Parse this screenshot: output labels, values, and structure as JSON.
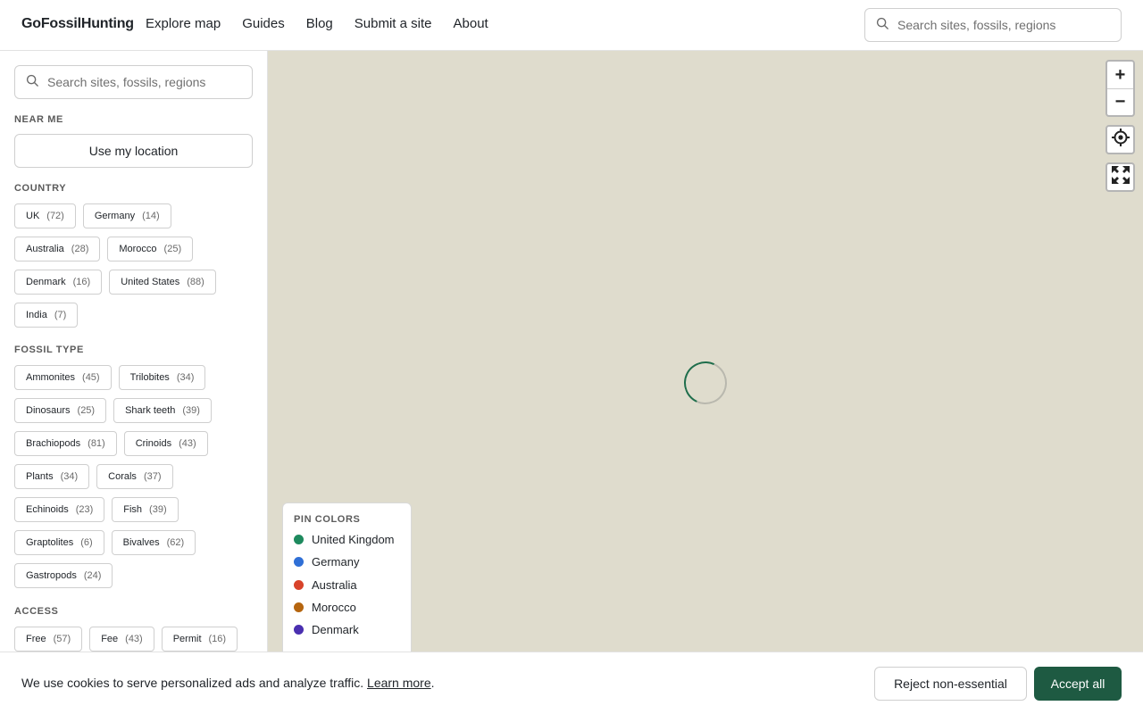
{
  "header": {
    "logo": "GoFossilHunting",
    "nav": [
      "Explore map",
      "Guides",
      "Blog",
      "Submit a site",
      "About"
    ],
    "search_placeholder": "Search sites, fossils, regions"
  },
  "sidebar": {
    "search_placeholder": "Search sites, fossils, regions",
    "near_me": {
      "title": "NEAR ME",
      "button": "Use my location"
    },
    "country": {
      "title": "COUNTRY",
      "chips": [
        {
          "label": "UK",
          "count": "(72)"
        },
        {
          "label": "Germany",
          "count": "(14)"
        },
        {
          "label": "Australia",
          "count": "(28)"
        },
        {
          "label": "Morocco",
          "count": "(25)"
        },
        {
          "label": "Denmark",
          "count": "(16)"
        },
        {
          "label": "United States",
          "count": "(88)"
        },
        {
          "label": "India",
          "count": "(7)"
        }
      ]
    },
    "fossil_type": {
      "title": "FOSSIL TYPE",
      "chips": [
        {
          "label": "Ammonites",
          "count": "(45)"
        },
        {
          "label": "Trilobites",
          "count": "(34)"
        },
        {
          "label": "Dinosaurs",
          "count": "(25)"
        },
        {
          "label": "Shark teeth",
          "count": "(39)"
        },
        {
          "label": "Brachiopods",
          "count": "(81)"
        },
        {
          "label": "Crinoids",
          "count": "(43)"
        },
        {
          "label": "Plants",
          "count": "(34)"
        },
        {
          "label": "Corals",
          "count": "(37)"
        },
        {
          "label": "Echinoids",
          "count": "(23)"
        },
        {
          "label": "Fish",
          "count": "(39)"
        },
        {
          "label": "Graptolites",
          "count": "(6)"
        },
        {
          "label": "Bivalves",
          "count": "(62)"
        },
        {
          "label": "Gastropods",
          "count": "(24)"
        }
      ]
    },
    "access": {
      "title": "ACCESS",
      "chips": [
        {
          "label": "Free",
          "count": "(57)"
        },
        {
          "label": "Fee",
          "count": "(43)"
        },
        {
          "label": "Permit",
          "count": "(16)"
        }
      ]
    }
  },
  "map": {
    "controls": {
      "zoom_in": "+",
      "zoom_out": "−"
    },
    "legend": {
      "title": "PIN COLORS",
      "items": [
        {
          "label": "United Kingdom",
          "color": "#1e8a5e"
        },
        {
          "label": "Germany",
          "color": "#2f6fd6"
        },
        {
          "label": "Australia",
          "color": "#d8432a"
        },
        {
          "label": "Morocco",
          "color": "#b5650f"
        },
        {
          "label": "Denmark",
          "color": "#4a2fb0"
        }
      ]
    }
  },
  "cookie": {
    "text": "We use cookies to serve personalized ads and analyze traffic.",
    "link": "Learn more",
    "suffix": ".",
    "reject": "Reject non-essential",
    "accept": "Accept all"
  },
  "colors": {
    "accent": "#1e5a42",
    "map_bg": "#dfdccd"
  }
}
